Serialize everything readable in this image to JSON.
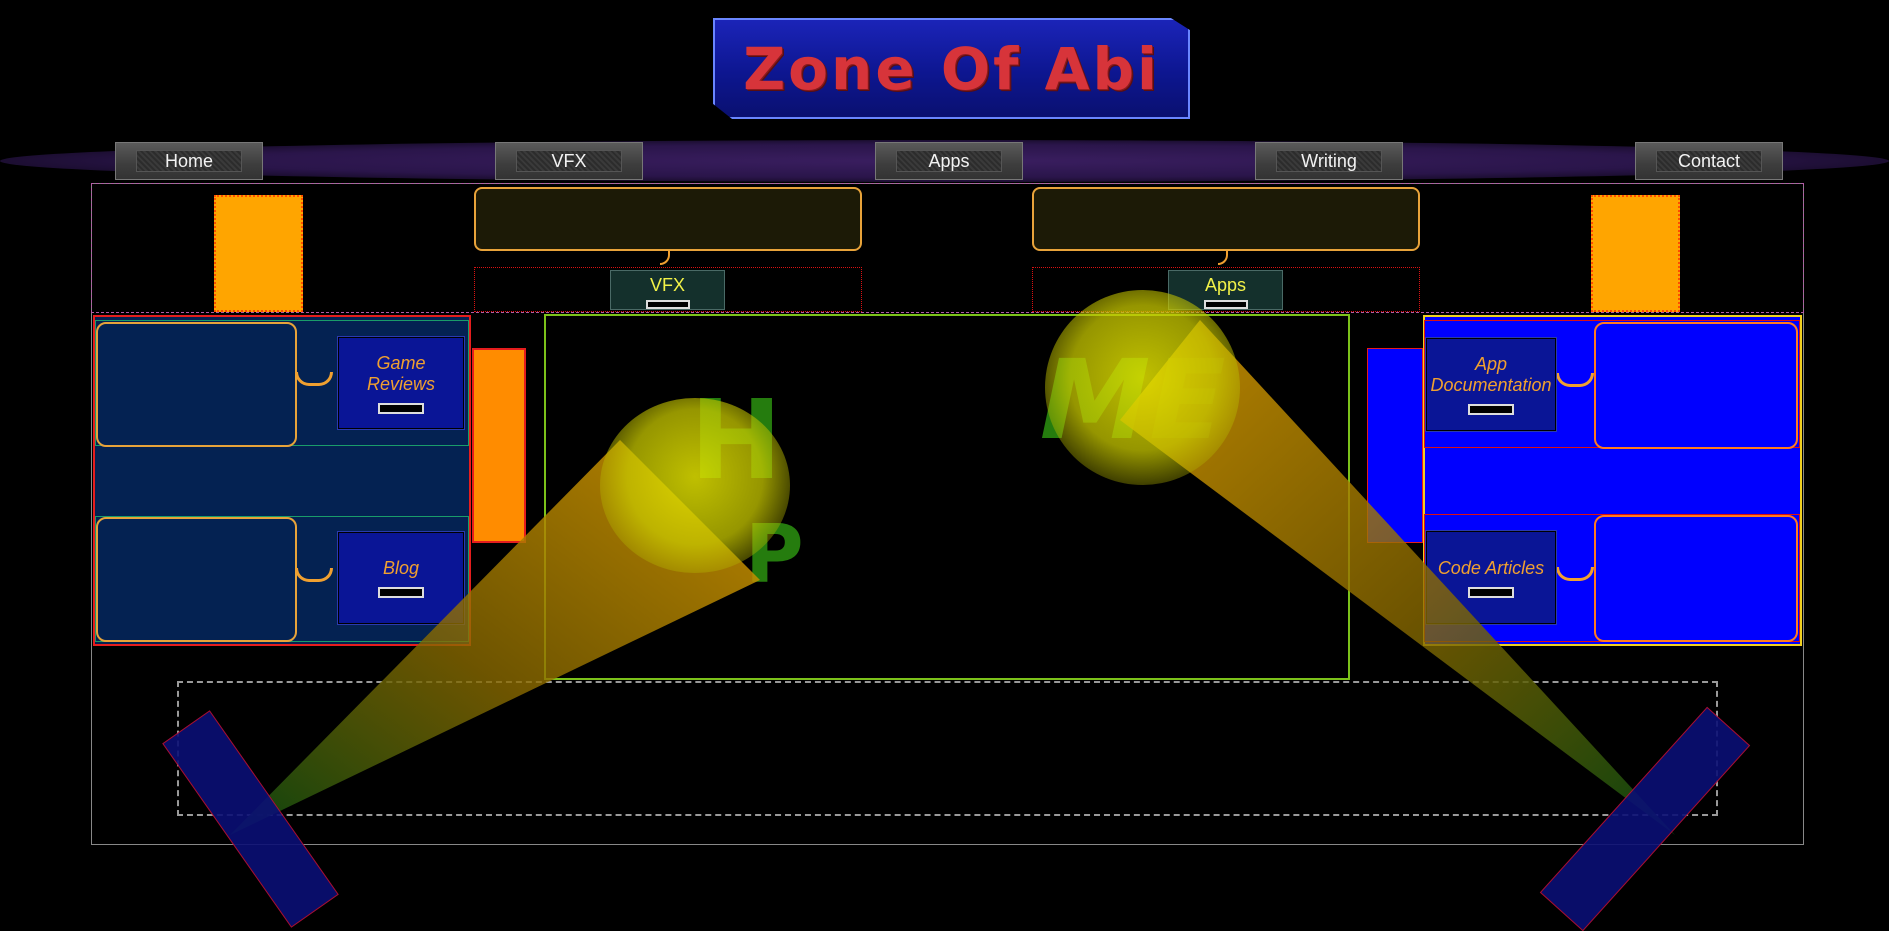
{
  "header": {
    "title": "Zone Of Abi"
  },
  "nav": {
    "items": [
      {
        "label": "Home"
      },
      {
        "label": "VFX"
      },
      {
        "label": "Apps"
      },
      {
        "label": "Writing"
      },
      {
        "label": "Contact"
      }
    ]
  },
  "top_cards": {
    "left": {
      "label": "VFX"
    },
    "right": {
      "label": "Apps"
    }
  },
  "left_panel": {
    "items": [
      {
        "label": "Game Reviews"
      },
      {
        "label": "Blog"
      }
    ]
  },
  "right_panel": {
    "items": [
      {
        "label": "App Documentation"
      },
      {
        "label": "Code Articles"
      }
    ]
  },
  "center_stage": {
    "ghost_text_left": "H",
    "ghost_text_right": "ME",
    "ghost_text_bottom": "P"
  },
  "colors": {
    "title_text": "#d7343a",
    "banner": "#1b24b8",
    "accent_orange": "#ffa500",
    "panel_left": "#042252",
    "panel_right": "#0000ff",
    "stage_border": "#7cc21a",
    "spotlight": "#e1e100"
  }
}
